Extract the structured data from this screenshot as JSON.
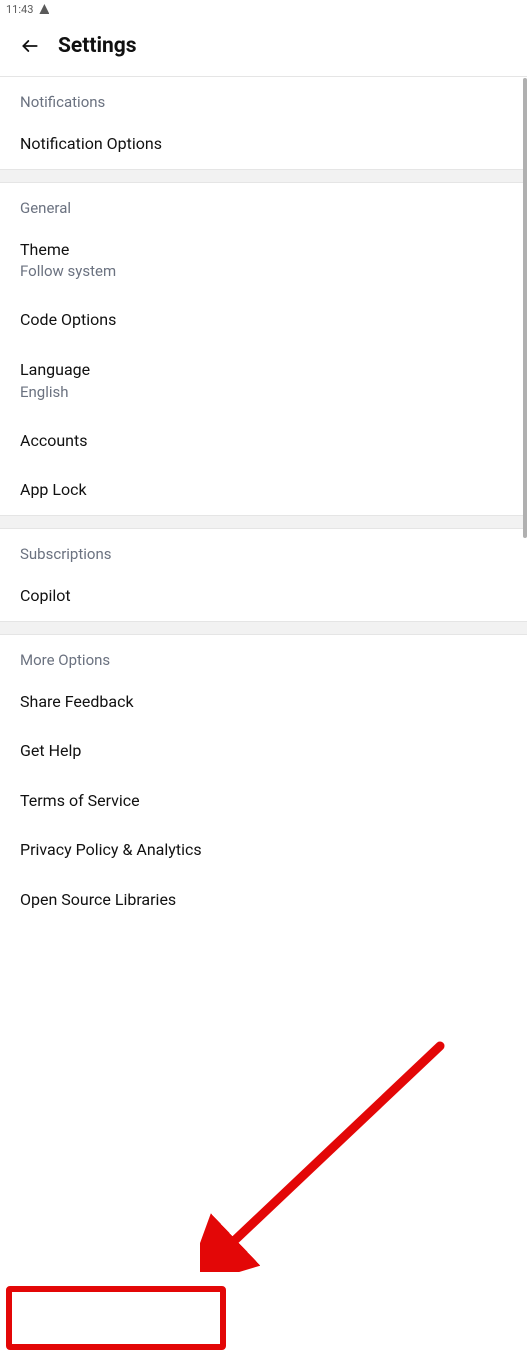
{
  "status": {
    "time": "11:43"
  },
  "header": {
    "title": "Settings"
  },
  "sections": {
    "notifications": {
      "title": "Notifications",
      "options": {
        "label": "Notification Options"
      }
    },
    "general": {
      "title": "General",
      "theme": {
        "label": "Theme",
        "value": "Follow system"
      },
      "code": {
        "label": "Code Options"
      },
      "language": {
        "label": "Language",
        "value": "English"
      },
      "accounts": {
        "label": "Accounts"
      },
      "applock": {
        "label": "App Lock"
      }
    },
    "subscriptions": {
      "title": "Subscriptions",
      "copilot": {
        "label": "Copilot"
      }
    },
    "more": {
      "title": "More Options",
      "feedback": {
        "label": "Share Feedback"
      },
      "help": {
        "label": "Get Help"
      },
      "tos": {
        "label": "Terms of Service"
      },
      "privacy": {
        "label": "Privacy Policy & Analytics"
      },
      "oss": {
        "label": "Open Source Libraries"
      }
    }
  }
}
